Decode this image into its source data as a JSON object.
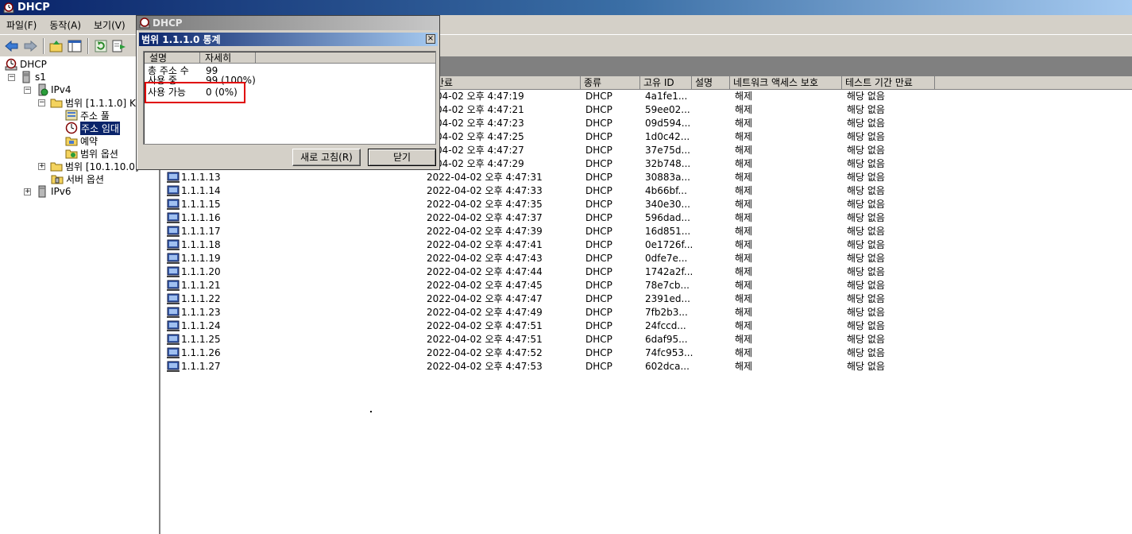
{
  "window": {
    "title": "DHCP"
  },
  "menu": {
    "items": [
      "파일(F)",
      "동작(A)",
      "보기(V)"
    ]
  },
  "toolbar": {
    "icons": [
      "back-arrow-icon",
      "forward-arrow-icon",
      "up-folder-icon",
      "show-hide-tree-icon",
      "refresh-icon",
      "export-list-icon"
    ]
  },
  "tree": {
    "root": "DHCP",
    "server": "s1",
    "ipv4": "IPv4",
    "scope1": "범위 [1.1.1.0] K",
    "address_pool": "주소 풀",
    "address_leases": "주소 임대",
    "reservations": "예약",
    "scope_options": "범위 옵션",
    "scope2": "범위 [10.1.10.0]",
    "server_options": "서버 옵션",
    "ipv6": "IPv6"
  },
  "columns": {
    "lease_expiration": "만료",
    "type": "종류",
    "unique_id": "고유 ID",
    "description": "설명",
    "nap": "네트워크 액세스 보호",
    "probation": "테스트 기간 만료"
  },
  "leases": [
    {
      "ip": "",
      "expires": "2-04-02 오후 4:47:19",
      "type": "DHCP",
      "uid": "4a1fe1...",
      "nap": "해제",
      "probation": "해당 없음"
    },
    {
      "ip": "",
      "expires": "2-04-02 오후 4:47:21",
      "type": "DHCP",
      "uid": "59ee02...",
      "nap": "해제",
      "probation": "해당 없음"
    },
    {
      "ip": "",
      "expires": "2-04-02 오후 4:47:23",
      "type": "DHCP",
      "uid": "09d594...",
      "nap": "해제",
      "probation": "해당 없음"
    },
    {
      "ip": "",
      "expires": "2-04-02 오후 4:47:25",
      "type": "DHCP",
      "uid": "1d0c42...",
      "nap": "해제",
      "probation": "해당 없음"
    },
    {
      "ip": "",
      "expires": "2-04-02 오후 4:47:27",
      "type": "DHCP",
      "uid": "37e75d...",
      "nap": "해제",
      "probation": "해당 없음"
    },
    {
      "ip": "",
      "expires": "2-04-02 오후 4:47:29",
      "type": "DHCP",
      "uid": "32b748...",
      "nap": "해제",
      "probation": "해당 없음"
    },
    {
      "ip": "1.1.1.13",
      "expires": "2022-04-02 오후 4:47:31",
      "type": "DHCP",
      "uid": "30883a...",
      "nap": "해제",
      "probation": "해당 없음"
    },
    {
      "ip": "1.1.1.14",
      "expires": "2022-04-02 오후 4:47:33",
      "type": "DHCP",
      "uid": "4b66bf...",
      "nap": "해제",
      "probation": "해당 없음"
    },
    {
      "ip": "1.1.1.15",
      "expires": "2022-04-02 오후 4:47:35",
      "type": "DHCP",
      "uid": "340e30...",
      "nap": "해제",
      "probation": "해당 없음"
    },
    {
      "ip": "1.1.1.16",
      "expires": "2022-04-02 오후 4:47:37",
      "type": "DHCP",
      "uid": "596dad...",
      "nap": "해제",
      "probation": "해당 없음"
    },
    {
      "ip": "1.1.1.17",
      "expires": "2022-04-02 오후 4:47:39",
      "type": "DHCP",
      "uid": "16d851...",
      "nap": "해제",
      "probation": "해당 없음"
    },
    {
      "ip": "1.1.1.18",
      "expires": "2022-04-02 오후 4:47:41",
      "type": "DHCP",
      "uid": "0e1726f...",
      "nap": "해제",
      "probation": "해당 없음"
    },
    {
      "ip": "1.1.1.19",
      "expires": "2022-04-02 오후 4:47:43",
      "type": "DHCP",
      "uid": "0dfe7e...",
      "nap": "해제",
      "probation": "해당 없음"
    },
    {
      "ip": "1.1.1.20",
      "expires": "2022-04-02 오후 4:47:44",
      "type": "DHCP",
      "uid": "1742a2f...",
      "nap": "해제",
      "probation": "해당 없음"
    },
    {
      "ip": "1.1.1.21",
      "expires": "2022-04-02 오후 4:47:45",
      "type": "DHCP",
      "uid": "78e7cb...",
      "nap": "해제",
      "probation": "해당 없음"
    },
    {
      "ip": "1.1.1.22",
      "expires": "2022-04-02 오후 4:47:47",
      "type": "DHCP",
      "uid": "2391ed...",
      "nap": "해제",
      "probation": "해당 없음"
    },
    {
      "ip": "1.1.1.23",
      "expires": "2022-04-02 오후 4:47:49",
      "type": "DHCP",
      "uid": "7fb2b3...",
      "nap": "해제",
      "probation": "해당 없음"
    },
    {
      "ip": "1.1.1.24",
      "expires": "2022-04-02 오후 4:47:51",
      "type": "DHCP",
      "uid": "24fccd...",
      "nap": "해제",
      "probation": "해당 없음"
    },
    {
      "ip": "1.1.1.25",
      "expires": "2022-04-02 오후 4:47:51",
      "type": "DHCP",
      "uid": "6daf95...",
      "nap": "해제",
      "probation": "해당 없음"
    },
    {
      "ip": "1.1.1.26",
      "expires": "2022-04-02 오후 4:47:52",
      "type": "DHCP",
      "uid": "74fc953...",
      "nap": "해제",
      "probation": "해당 없음"
    },
    {
      "ip": "1.1.1.27",
      "expires": "2022-04-02 오후 4:47:53",
      "type": "DHCP",
      "uid": "602dca...",
      "nap": "해제",
      "probation": "해당 없음"
    }
  ],
  "dialog": {
    "window_title": "DHCP",
    "title": "범위 1.1.1.0 통계",
    "close_glyph": "×",
    "col_description": "설명",
    "col_details": "자세히",
    "stats": [
      {
        "label": "총 주소 수",
        "value": "99"
      },
      {
        "label": "사용 중",
        "value": "99 (100%)"
      },
      {
        "label": "사용 가능",
        "value": "0 (0%)"
      }
    ],
    "refresh_button": "새로 고침(R)",
    "close_button": "닫기"
  },
  "colors": {
    "title_active": "#0a246a",
    "highlight": "#e00000",
    "chrome": "#d4d0c8"
  }
}
